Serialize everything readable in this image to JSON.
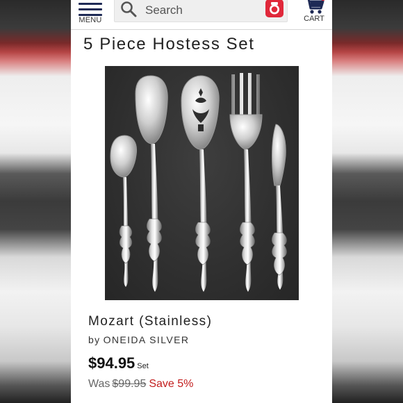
{
  "header": {
    "menu_label": "MENU",
    "search_placeholder": "Search",
    "cart_label": "CART"
  },
  "page": {
    "title": "5 Piece Hostess Set"
  },
  "product": {
    "image_alt": "5 piece stainless serving set on dark slate background",
    "name": "Mozart (Stainless)",
    "brand_prefix": "by",
    "brand": "ONEIDA SILVER",
    "price": "$94.95",
    "price_unit": "Set",
    "was_label": "Was",
    "was_price": "$99.95",
    "save_text": "Save 5%"
  },
  "colors": {
    "brand_navy": "#1e2a55",
    "camera_red": "#e0283a",
    "sale_red": "#c21d1d"
  },
  "icons": [
    "menu-icon",
    "search-icon",
    "camera-icon",
    "cart-icon"
  ]
}
